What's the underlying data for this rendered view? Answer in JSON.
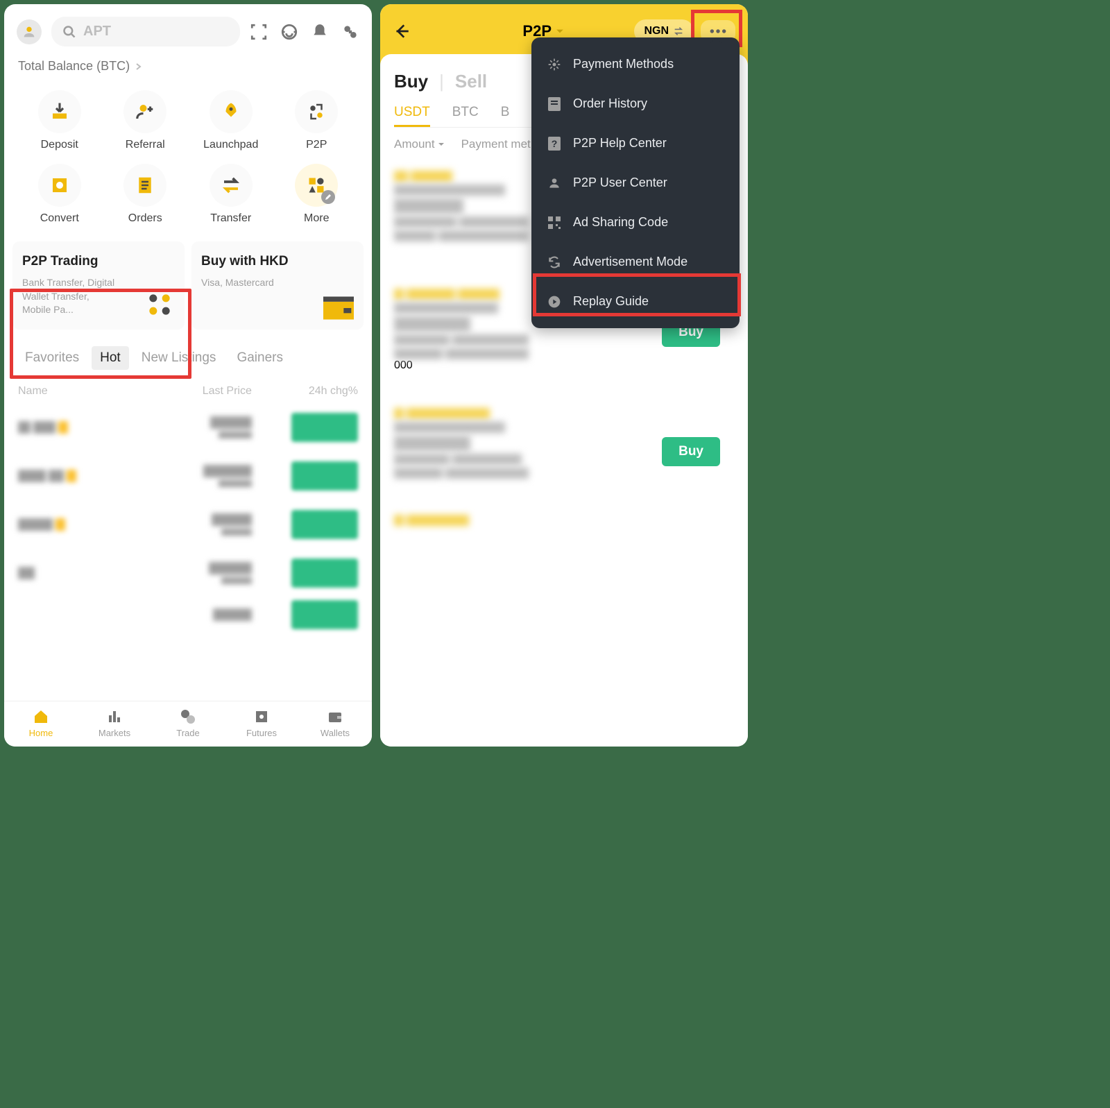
{
  "screen1": {
    "search_placeholder": "APT",
    "balance_label": "Total Balance (BTC)",
    "shortcuts": [
      {
        "label": "Deposit"
      },
      {
        "label": "Referral"
      },
      {
        "label": "Launchpad"
      },
      {
        "label": "P2P"
      },
      {
        "label": "Convert"
      },
      {
        "label": "Orders"
      },
      {
        "label": "Transfer"
      },
      {
        "label": "More"
      }
    ],
    "cards": [
      {
        "title": "P2P Trading",
        "sub": "Bank Transfer, Digital Wallet Transfer, Mobile Pa..."
      },
      {
        "title": "Buy with HKD",
        "sub": "Visa, Mastercard"
      }
    ],
    "market_tabs": [
      "Favorites",
      "Hot",
      "New Listings",
      "Gainers"
    ],
    "market_tab_active": 1,
    "list_headers": {
      "name": "Name",
      "price": "Last Price",
      "chg": "24h chg%"
    },
    "nav": [
      "Home",
      "Markets",
      "Trade",
      "Futures",
      "Wallets"
    ],
    "nav_active": 0
  },
  "screen2": {
    "title": "P2P",
    "fiat": "NGN",
    "buy": "Buy",
    "sell": "Sell",
    "crypto_tabs": [
      "USDT",
      "BTC",
      "B"
    ],
    "crypto_active": 0,
    "filters": {
      "amount": "Amount",
      "payment": "Payment met"
    },
    "buy_label": "Buy",
    "menu": [
      {
        "icon": "gear",
        "label": "Payment Methods"
      },
      {
        "icon": "doc",
        "label": "Order History"
      },
      {
        "icon": "help",
        "label": "P2P Help Center"
      },
      {
        "icon": "user",
        "label": "P2P User Center"
      },
      {
        "icon": "qr",
        "label": "Ad Sharing Code"
      },
      {
        "icon": "refresh",
        "label": "Advertisement Mode"
      },
      {
        "icon": "play",
        "label": "Replay Guide"
      }
    ]
  }
}
